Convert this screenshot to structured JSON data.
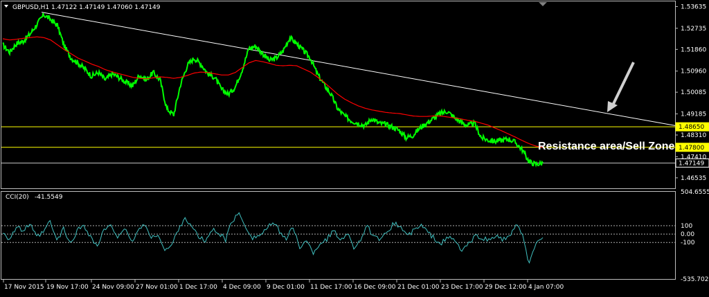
{
  "header": {
    "symbol_line": "GBPUSD,H1  1.47122 1.47149 1.47060 1.47149"
  },
  "annotation": "Resistance area/Sell Zone",
  "chart_data": [
    {
      "type": "line",
      "title": "GBPUSD,H1",
      "ohlc": {
        "open": 1.47122,
        "high": 1.47149,
        "low": 1.4706,
        "close": 1.47149
      },
      "ylim": [
        1.461,
        1.5385
      ],
      "y_ticks": [
        "1.53635",
        "1.52735",
        "1.51860",
        "1.50960",
        "1.50085",
        "1.49185",
        "1.48310",
        "1.47410",
        "1.46535"
      ],
      "x_ticks": [
        "17 Nov 2015",
        "19 Nov 17:00",
        "24 Nov 09:00",
        "27 Nov 01:00",
        "1 Dec 17:00",
        "4 Dec 09:00",
        "9 Dec 01:00",
        "11 Dec 17:00",
        "16 Dec 09:00",
        "21 Dec 01:00",
        "23 Dec 17:00",
        "29 Dec 12:00",
        "4 Jan 07:00"
      ],
      "horizontal_levels": [
        {
          "value": 1.4865,
          "label": "1.48650",
          "color": "#ffff00"
        },
        {
          "value": 1.478,
          "label": "1.47800",
          "color": "#ffff00"
        },
        {
          "value": 1.47149,
          "label": "1.47149",
          "color": "#c0c0c0"
        }
      ],
      "series": [
        {
          "values": [
            1.5205,
            1.5175,
            1.521,
            1.522,
            1.525,
            1.529,
            1.533,
            1.531,
            1.5285,
            1.52,
            1.515,
            1.513,
            1.5105,
            1.5075,
            1.509,
            1.506,
            1.5085,
            1.507,
            1.505,
            1.5035,
            1.508,
            1.506,
            1.509,
            1.506,
            1.494,
            1.4915,
            1.504,
            1.512,
            1.515,
            1.5125,
            1.5085,
            1.507,
            1.502,
            1.5,
            1.503,
            1.51,
            1.519,
            1.52,
            1.517,
            1.514,
            1.515,
            1.518,
            1.5235,
            1.521,
            1.518,
            1.515,
            1.5085,
            1.504,
            1.5,
            1.494,
            1.491,
            1.489,
            1.488,
            1.487,
            1.49,
            1.488,
            1.4875,
            1.4865,
            1.485,
            1.482,
            1.483,
            1.486,
            1.488,
            1.49,
            1.492,
            1.493,
            1.4905,
            1.4885,
            1.487,
            1.488,
            1.482,
            1.481,
            1.4805,
            1.481,
            1.4815,
            1.48,
            1.477,
            1.472,
            1.471,
            1.4715
          ],
          "color": "#00ff00"
        },
        {
          "values": [
            1.523,
            1.5225,
            1.5228,
            1.5232,
            1.5235,
            1.5238,
            1.5235,
            1.5225,
            1.5205,
            1.5185,
            1.5168,
            1.515,
            1.5138,
            1.5125,
            1.5115,
            1.5102,
            1.5093,
            1.5085,
            1.5078,
            1.507,
            1.5066,
            1.5064,
            1.5068,
            1.5072,
            1.507,
            1.5066,
            1.507,
            1.5078,
            1.5088,
            1.5092,
            1.509,
            1.5085,
            1.508,
            1.508,
            1.509,
            1.511,
            1.513,
            1.514,
            1.5135,
            1.5128,
            1.512,
            1.5118,
            1.512,
            1.5118,
            1.5105,
            1.5092,
            1.5072,
            1.505,
            1.5025,
            1.5,
            1.498,
            1.4965,
            1.4952,
            1.4942,
            1.4935,
            1.493,
            1.4925,
            1.4922,
            1.492,
            1.4915,
            1.491,
            1.4908,
            1.4908,
            1.491,
            1.491,
            1.4906,
            1.4902,
            1.4898,
            1.4892,
            1.4888,
            1.488,
            1.4872,
            1.486,
            1.4848,
            1.4835,
            1.4822,
            1.4808,
            1.4795,
            1.4785,
            1.478
          ],
          "color": "#ff0000"
        }
      ],
      "trendline": {
        "from": 1.534,
        "to": 1.487,
        "color": "#ffffff"
      }
    },
    {
      "type": "line",
      "title": "CCI(20)",
      "value_label": "-41.5549",
      "ylim": [
        -535.7025,
        504.6555
      ],
      "y_ticks": [
        "504.6555",
        "100",
        "0.00",
        "-100",
        "-535.7025"
      ],
      "levels": [
        100,
        0,
        -100
      ],
      "series": [
        {
          "values": [
            30,
            -60,
            80,
            40,
            120,
            -40,
            20,
            150,
            -80,
            60,
            -120,
            40,
            110,
            -30,
            -150,
            50,
            90,
            -20,
            70,
            -100,
            30,
            130,
            -60,
            10,
            -200,
            -140,
            60,
            200,
            80,
            -30,
            -90,
            50,
            20,
            -70,
            160,
            240,
            90,
            -40,
            -20,
            60,
            130,
            40,
            -60,
            80,
            -150,
            -90,
            -220,
            -110,
            -60,
            40,
            -70,
            20,
            -160,
            -60,
            90,
            -40,
            -80,
            40,
            130,
            80,
            -20,
            50,
            100,
            20,
            -60,
            -110,
            -40,
            -80,
            -200,
            -120,
            -30,
            -40,
            -80,
            -20,
            -60,
            -50,
            120,
            -30,
            -360,
            -120,
            -41.5549
          ],
          "color": "#40c0c0"
        }
      ]
    }
  ]
}
